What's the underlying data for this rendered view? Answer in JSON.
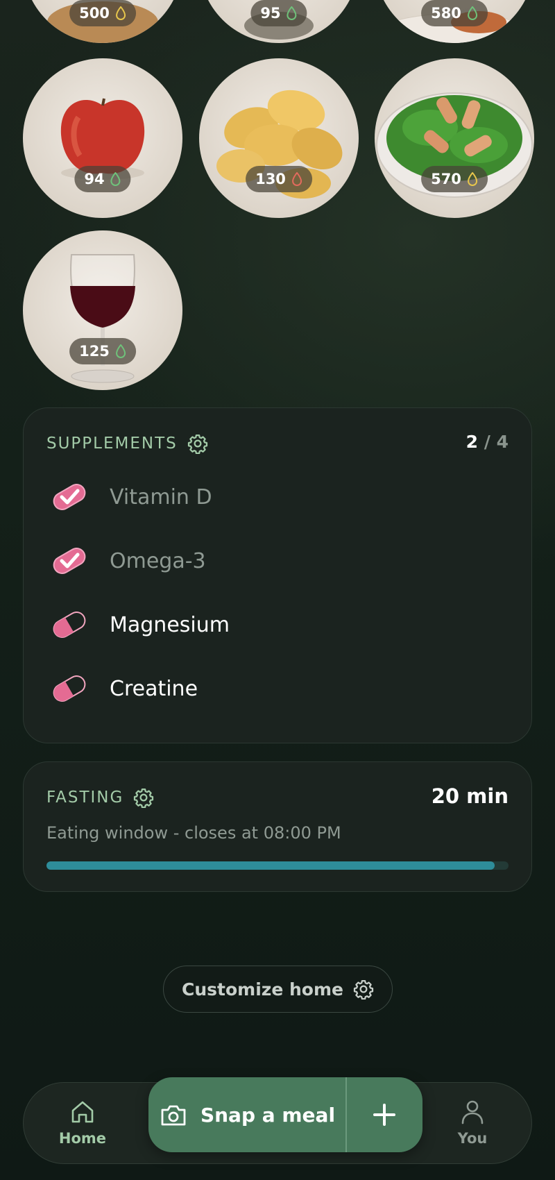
{
  "meals": [
    {
      "name": "top-left",
      "calories": "500",
      "drop_color": "#e7c64c"
    },
    {
      "name": "top-middle",
      "calories": "95",
      "drop_color": "#6fc27a"
    },
    {
      "name": "top-right",
      "calories": "580",
      "drop_color": "#6fc27a"
    },
    {
      "name": "apple",
      "calories": "94",
      "drop_color": "#6fc27a"
    },
    {
      "name": "chips",
      "calories": "130",
      "drop_color": "#e26a5d"
    },
    {
      "name": "salad",
      "calories": "570",
      "drop_color": "#e7c64c"
    },
    {
      "name": "wine",
      "calories": "125",
      "drop_color": "#6fc27a"
    }
  ],
  "supplements": {
    "title": "SUPPLEMENTS",
    "taken": "2",
    "separator": "/",
    "total": "4",
    "items": [
      {
        "label": "Vitamin D",
        "done": true
      },
      {
        "label": "Omega-3",
        "done": true
      },
      {
        "label": "Magnesium",
        "done": false
      },
      {
        "label": "Creatine",
        "done": false
      }
    ]
  },
  "fasting": {
    "title": "FASTING",
    "time": "20 min",
    "subtitle": "Eating window - closes at 08:00 PM",
    "progress": 0.97
  },
  "customize_label": "Customize home",
  "nav": {
    "home_label": "Home",
    "you_label": "You",
    "snap_label": "Snap a meal"
  },
  "colors": {
    "accent_green": "#a3cba8",
    "progress_teal": "#2e8d9a",
    "pill_pink": "#e46b93",
    "snap_button": "#487a5c"
  }
}
